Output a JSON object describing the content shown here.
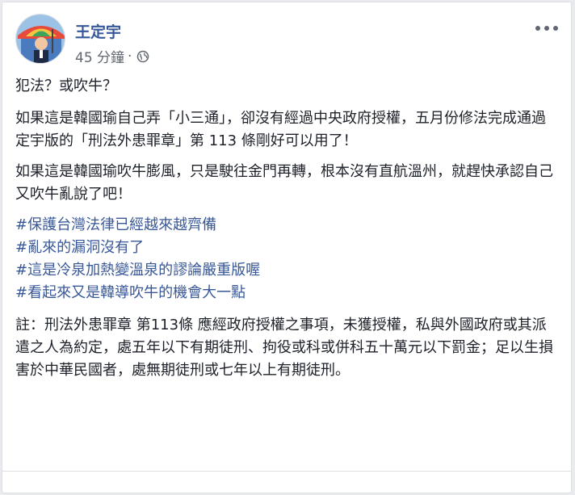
{
  "post": {
    "author": "王定宇",
    "time": "45 分鐘",
    "separator": "·",
    "privacy_icon": "globe-icon",
    "more_icon": "more-options-icon",
    "title": "犯法？或吹牛？",
    "paragraph1": "如果這是韓國瑜自己弄「小三通」，卻沒有經過中央政府授權，五月份修法完成通過定宇版的「刑法外患罪章」第 113 條剛好可以用了！",
    "paragraph2": "如果這是韓國瑜吹牛膨風，只是駛往金門再轉，根本沒有直航溫州，就趕快承認自己又吹牛亂說了吧！",
    "hashtags": [
      "#保護台灣法律已經越來越齊備",
      "#亂來的漏洞沒有了",
      "#這是冷泉加熱變溫泉的謬論嚴重版喔",
      "#看起來又是韓導吹牛的機會大一點"
    ],
    "note": "註：刑法外患罪章 第113條 應經政府授權之事項，未獲授權，私與外國政府或其派遣之人為約定，處五年以下有期徒刑、拘役或科或併科五十萬元以下罰金；足以生損害於中華民國者，處無期徒刑或七年以上有期徒刑。"
  },
  "colors": {
    "author": "#365899",
    "hashtag": "#385898",
    "text": "#1d2129",
    "meta": "#616770",
    "background": "#e9ebee"
  }
}
